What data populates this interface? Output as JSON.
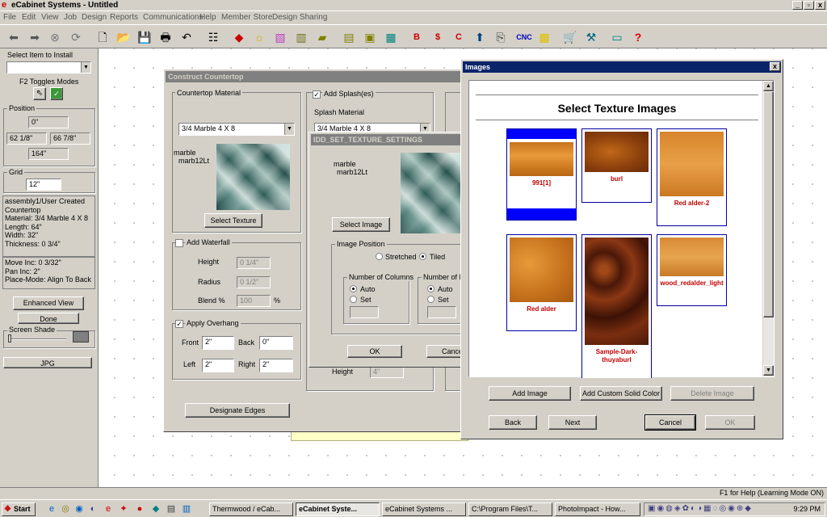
{
  "window": {
    "title": "eCabinet Systems - Untitled",
    "min": "_",
    "restore": "▫",
    "close": "x"
  },
  "menu": [
    "File",
    "Edit",
    "View",
    "Job",
    "Design",
    "Reports",
    "Communications",
    "Help",
    "Member Store",
    "Design Sharing"
  ],
  "toolbar": {
    "icons": [
      "back-arrow-icon",
      "forward-arrow-icon",
      "stop-icon",
      "refresh-icon",
      "new-file-icon",
      "open-folder-icon",
      "save-icon",
      "print-icon",
      "undo-icon",
      "settings-icon",
      "material-icon",
      "light-icon",
      "texture-icon",
      "molding-icon",
      "panel-icon",
      "cabinet-icon",
      "cabinet-doors-icon",
      "grid-icon",
      "bid-report-icon",
      "cost-report-icon",
      "cut-report-icon",
      "label-icon",
      "export-icon",
      "cnc-icon",
      "color-icon",
      "cart-icon",
      "tools-icon",
      "monitor-icon",
      "help-icon"
    ],
    "cnc_label": "CNC",
    "help_glyph": "?"
  },
  "left_panel": {
    "select_item_label": "Select Item to Install",
    "f2_label": "F2 Toggles Modes",
    "position_label": "Position",
    "pos_top": "0\"",
    "pos_left": "62 1/8\"",
    "pos_right": "66 7/8\"",
    "pos_bottom": "164\"",
    "grid_label": "Grid",
    "grid_value": "12\"",
    "info_lines": [
      "assembly1/User Created",
      "Countertop",
      " Material: 3/4 Marble 4 X 8",
      " Length: 64\"",
      " Width: 32\"",
      " Thickness: 0 3/4\""
    ],
    "move_lines": [
      "Move Inc: 0 3/32\"",
      "Pan Inc: 2\"",
      "Place-Mode: Align To Back"
    ],
    "enhanced_view": "Enhanced View",
    "done": "Done",
    "screen_shade": "Screen Shade",
    "jpg": "JPG"
  },
  "construct_dialog": {
    "title": "Construct Countertop",
    "countertop_material_label": "Countertop Material",
    "material_value": "3/4 Marble 4 X 8",
    "texture_name": "marble",
    "texture_file": "marb12Lt",
    "select_texture": "Select Texture",
    "add_waterfall": "Add Waterfall",
    "height_label": "Height",
    "height_value": "0 1/4\"",
    "radius_label": "Radius",
    "radius_value": "0 1/2\"",
    "blend_label": "Blend %",
    "blend_value": "100",
    "blend_unit": "%",
    "apply_overhang": "Apply Overhang",
    "front_label": "Front",
    "front_value": "2\"",
    "back_label": "Back",
    "back_value": "0\"",
    "left_label": "Left",
    "left_value": "2\"",
    "right_label": "Right",
    "right_value": "2\"",
    "add_splash": "Add Splash(es)",
    "splash_material_label": "Splash Material",
    "splash_material_value": "3/4 Marble 4 X 8",
    "splash_height_label": "Height",
    "splash_height_value": "4\"",
    "designate_edges": "Designate Edges"
  },
  "texture_settings_dialog": {
    "title": "IDD_SET_TEXTURE_SETTINGS",
    "texture_name": "marble",
    "texture_file": "marb12Lt",
    "select_image": "Select Image",
    "image_position_label": "Image Position",
    "stretched": "Stretched",
    "tiled": "Tiled",
    "num_columns_label": "Number of Columns",
    "num_rows_label": "Number of R",
    "auto": "Auto",
    "set": "Set",
    "ok": "OK",
    "cancel": "Cance"
  },
  "images_dialog": {
    "title": "Images",
    "close": "x",
    "header": "Select Texture Images",
    "thumbnails": [
      {
        "label": "991[1]",
        "texture": "wood1"
      },
      {
        "label": "burl",
        "texture": "wood2"
      },
      {
        "label": "Red alder-2",
        "texture": "wood3"
      },
      {
        "label": "Red alder",
        "texture": "wood4"
      },
      {
        "label": "Sample-Dark-thuyaburl",
        "texture": "wood5"
      },
      {
        "label": "wood_redalder_light",
        "texture": "wood6"
      }
    ],
    "add_image": "Add Image",
    "add_custom_solid_color": "Add Custom Solid Color",
    "delete_image": "Delete Image",
    "back": "Back",
    "next": "Next",
    "cancel": "Cancel",
    "ok": "OK"
  },
  "status_bar": {
    "help_text": "F1 for Help (Learning Mode ON)"
  },
  "taskbar": {
    "start": "Start",
    "tasks": [
      "Thermwood / eCab...",
      "eCabinet Syste...",
      "eCabinet Systems ...",
      "C:\\Program Files\\T...",
      "PhotoImpact - How..."
    ],
    "clock": "9:29 PM"
  },
  "colors": {
    "selection_blue": "#0000ff",
    "label_red": "#c00000",
    "dialog_gray": "#d4d0c8",
    "title_blue": "#0a246a"
  }
}
